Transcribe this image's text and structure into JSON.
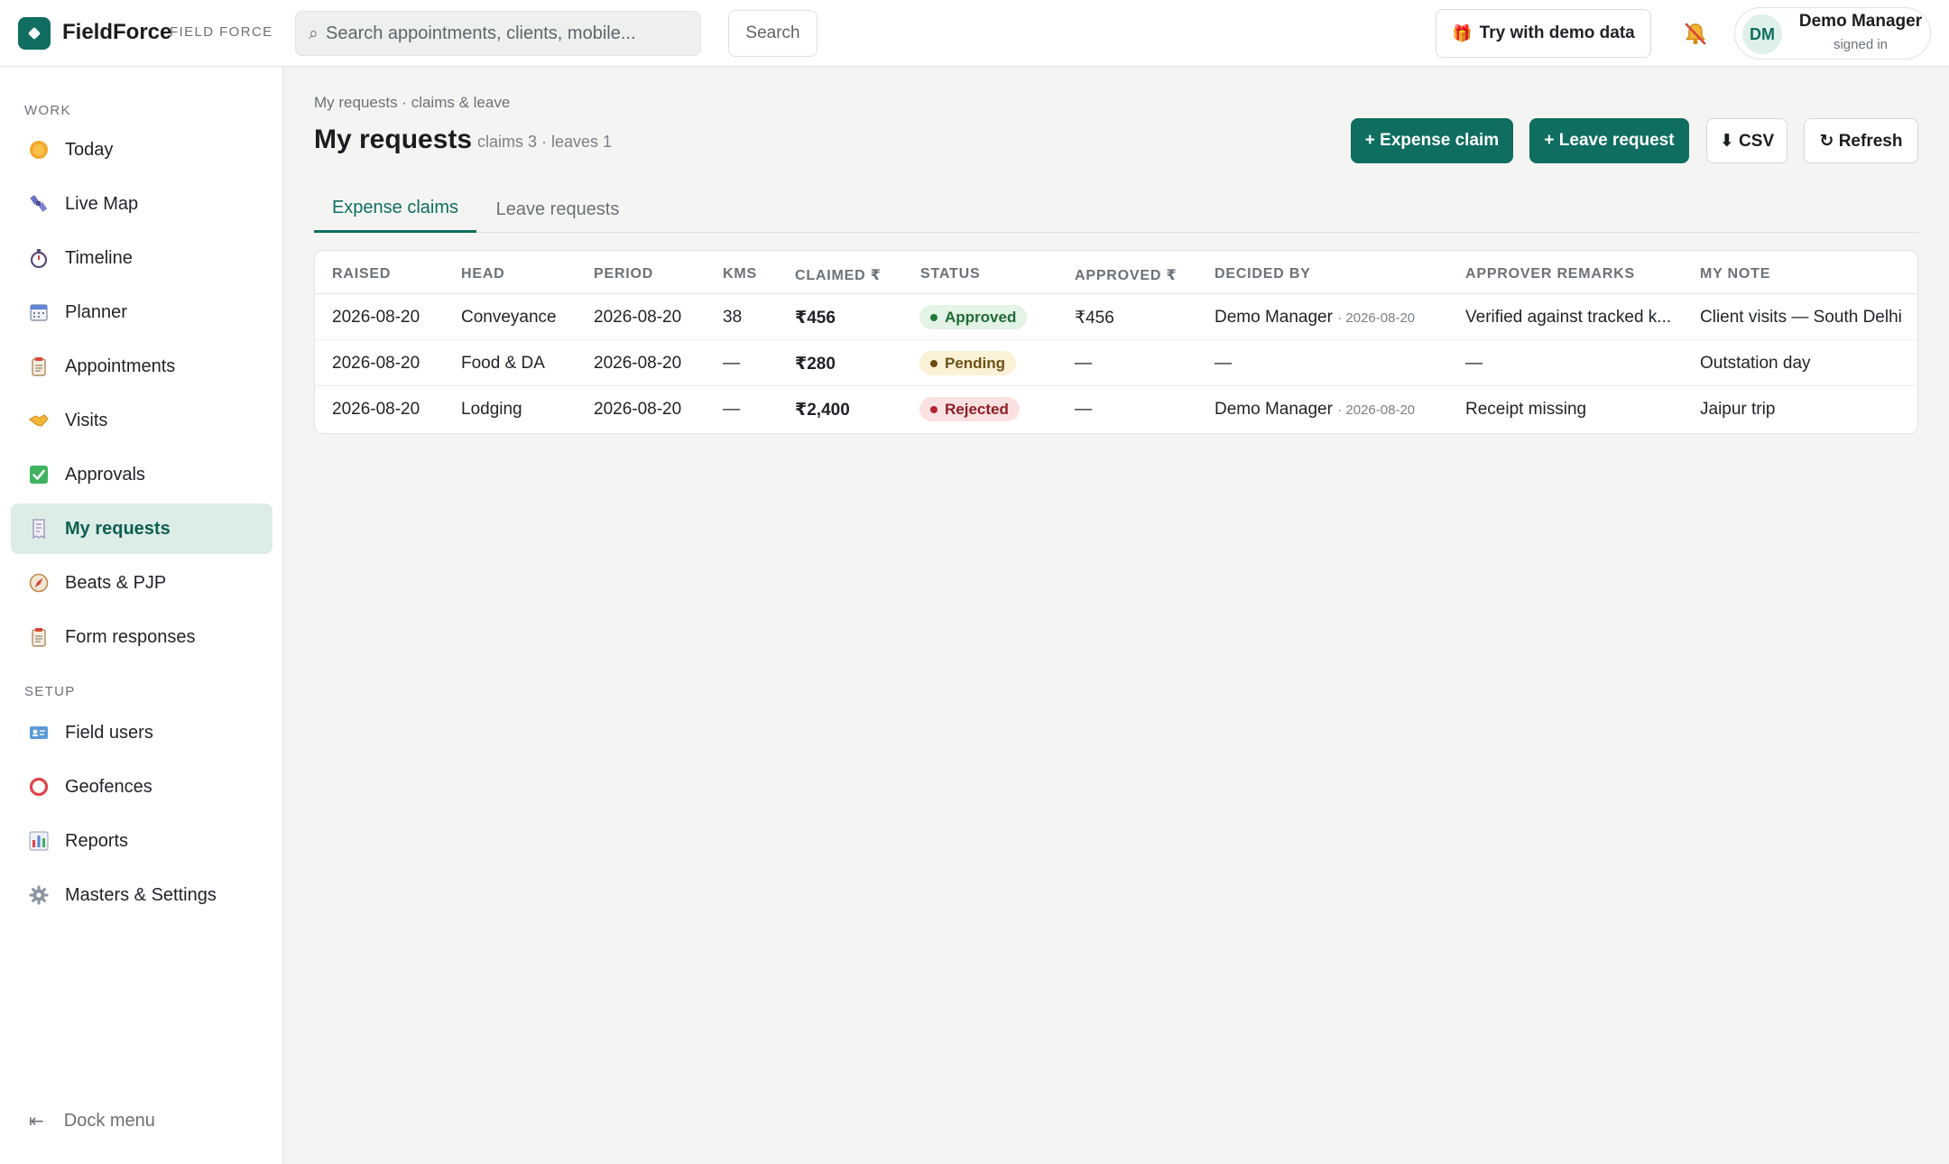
{
  "app": {
    "brand": "FieldForce",
    "brand_sub": "FIELD FORCE"
  },
  "topbar": {
    "search_placeholder": "Search appointments, clients, mobile...",
    "search_button": "Search",
    "demo_button": "Try with demo data",
    "user": {
      "initials": "DM",
      "name": "Demo Manager",
      "status": "signed in"
    }
  },
  "sidebar": {
    "work_label": "WORK",
    "setup_label": "SETUP",
    "work_items": [
      {
        "label": "Today",
        "icon": "sun-icon"
      },
      {
        "label": "Live Map",
        "icon": "satellite-icon"
      },
      {
        "label": "Timeline",
        "icon": "stopwatch-icon"
      },
      {
        "label": "Planner",
        "icon": "calendar-icon"
      },
      {
        "label": "Appointments",
        "icon": "clipboard-icon"
      },
      {
        "label": "Visits",
        "icon": "handshake-icon"
      },
      {
        "label": "Approvals",
        "icon": "check-box-icon"
      },
      {
        "label": "My requests",
        "icon": "receipt-icon",
        "active": true
      },
      {
        "label": "Beats & PJP",
        "icon": "compass-icon"
      },
      {
        "label": "Form responses",
        "icon": "clipboard-icon"
      }
    ],
    "setup_items": [
      {
        "label": "Field users",
        "icon": "id-card-icon"
      },
      {
        "label": "Geofences",
        "icon": "ring-icon"
      },
      {
        "label": "Reports",
        "icon": "bar-chart-icon"
      },
      {
        "label": "Masters & Settings",
        "icon": "gear-icon"
      }
    ],
    "dock_label": "Dock menu"
  },
  "page": {
    "breadcrumb": "My requests · claims & leave",
    "title": "My requests",
    "counts": "claims 3 · leaves 1",
    "actions": {
      "expense_claim": "+ Expense claim",
      "leave_request": "+ Leave request",
      "csv": "⬇ CSV",
      "refresh": "↻ Refresh"
    },
    "tabs": [
      "Expense claims",
      "Leave requests"
    ]
  },
  "table": {
    "columns": [
      "RAISED",
      "HEAD",
      "PERIOD",
      "KMS",
      "CLAIMED ₹",
      "STATUS",
      "APPROVED ₹",
      "DECIDED BY",
      "APPROVER REMARKS",
      "MY NOTE"
    ],
    "rows": [
      {
        "raised": "2026-08-20",
        "head": "Conveyance",
        "period": "2026-08-20",
        "kms": "38",
        "claimed": "₹456",
        "status": "Approved",
        "approved": "₹456",
        "decided_by": "Demo Manager",
        "decided_date": "· 2026-08-20",
        "remarks": "Verified against tracked k...",
        "note": "Client visits — South Delhi"
      },
      {
        "raised": "2026-08-20",
        "head": "Food & DA",
        "period": "2026-08-20",
        "kms": "—",
        "claimed": "₹280",
        "status": "Pending",
        "approved": "—",
        "decided_by": "—",
        "decided_date": "",
        "remarks": "—",
        "note": "Outstation day"
      },
      {
        "raised": "2026-08-20",
        "head": "Lodging",
        "period": "2026-08-20",
        "kms": "—",
        "claimed": "₹2,400",
        "status": "Rejected",
        "approved": "—",
        "decided_by": "Demo Manager",
        "decided_date": "· 2026-08-20",
        "remarks": "Receipt missing",
        "note": "Jaipur trip"
      }
    ]
  },
  "colors": {
    "brand": "#0f6e5f",
    "active_nav_bg": "#dcede7",
    "approved": "#1f7a3c",
    "pending": "#6e4a0e",
    "rejected": "#b3242c"
  }
}
